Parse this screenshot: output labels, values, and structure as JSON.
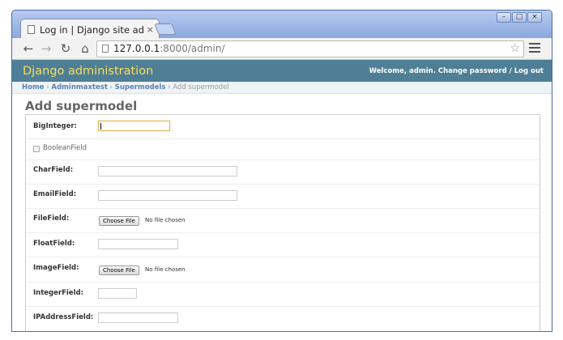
{
  "browser": {
    "tab_title": "Log in | Django site ad",
    "tab_close": "×",
    "url_host": "127.0.0.1",
    "url_rest": ":8000/admin/",
    "window_controls": {
      "minimize": "–",
      "maximize": "□",
      "close": "×"
    },
    "nav": {
      "back": "←",
      "forward": "→",
      "reload": "↻",
      "home": "⌂",
      "star": "☆"
    }
  },
  "header": {
    "branding": "Django administration",
    "user_tools": "Welcome, admin. Change password / Log out"
  },
  "breadcrumbs": {
    "items": [
      "Home",
      "Adminmaxtest",
      "Supermodels"
    ],
    "separator": " › ",
    "current": "Add supermodel"
  },
  "page_title": "Add supermodel",
  "form": {
    "fields": [
      {
        "label": "BigInteger:",
        "type": "text",
        "value": ""
      },
      {
        "label": "BooleanField",
        "type": "checkbox",
        "checked": false
      },
      {
        "label": "CharField:",
        "type": "text",
        "value": ""
      },
      {
        "label": "EmailField:",
        "type": "text",
        "value": ""
      },
      {
        "label": "FileField:",
        "type": "file",
        "button": "Choose File",
        "status": "No file chosen"
      },
      {
        "label": "FloatField:",
        "type": "text",
        "value": ""
      },
      {
        "label": "ImageField:",
        "type": "file",
        "button": "Choose File",
        "status": "No file chosen"
      },
      {
        "label": "IntegerField:",
        "type": "text",
        "value": ""
      },
      {
        "label": "IPAddressField:",
        "type": "text",
        "value": ""
      }
    ]
  },
  "colors": {
    "header_bg": "#4f7f96",
    "branding": "#f5dd5d",
    "breadcrumb_link": "#5b80b2",
    "focus_border": "#e0b050"
  }
}
